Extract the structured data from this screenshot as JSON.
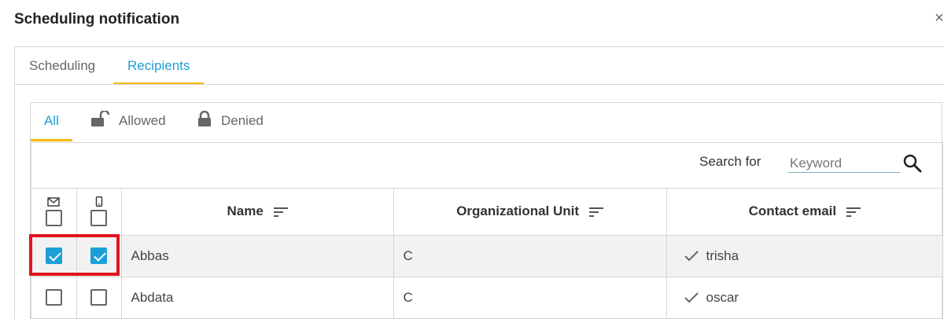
{
  "dialog": {
    "title": "Scheduling notification"
  },
  "tabs": [
    {
      "label": "Scheduling",
      "active": false
    },
    {
      "label": "Recipients",
      "active": true
    }
  ],
  "filters": [
    {
      "label": "All",
      "icon": "",
      "active": true
    },
    {
      "label": "Allowed",
      "icon": "unlocked-padlock-icon",
      "active": false
    },
    {
      "label": "Denied",
      "icon": "locked-padlock-icon",
      "active": false
    }
  ],
  "search": {
    "label": "Search for",
    "placeholder": "Keyword",
    "value": ""
  },
  "table": {
    "columns": {
      "email_icon": "envelope-icon",
      "mobile_icon": "mobile-phone-icon",
      "name": "Name",
      "organizational_unit": "Organizational Unit",
      "contact_email": "Contact email"
    },
    "rows": [
      {
        "email_checked": true,
        "mobile_checked": true,
        "name": "Abbas",
        "organizational_unit": "C",
        "contact_email": "trisha",
        "selected": true
      },
      {
        "email_checked": false,
        "mobile_checked": false,
        "name": "Abdata",
        "organizational_unit": "C",
        "contact_email": "oscar",
        "selected": false
      }
    ]
  },
  "colors": {
    "accent": "#1aa0d8",
    "tab_underline": "#f5b800",
    "highlight": "#e0141e"
  }
}
